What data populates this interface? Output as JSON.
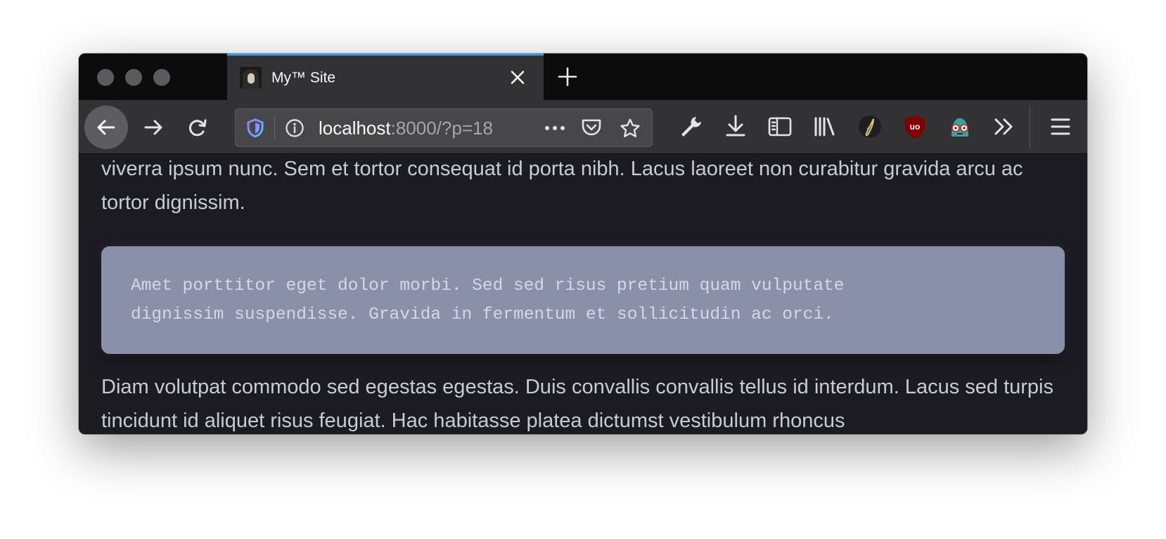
{
  "tab": {
    "title": "My™ Site",
    "favicon": "portrait-favicon"
  },
  "toolbar": {
    "url_host": "localhost",
    "url_rest": ":8000/?p=18",
    "icons": [
      "back-arrow-icon",
      "forward-arrow-icon",
      "reload-icon",
      "tracking-shield-icon",
      "site-info-icon",
      "page-actions-icon",
      "pocket-icon",
      "bookmark-star-icon",
      "wrench-icon",
      "download-icon",
      "sidebar-icon",
      "library-icon",
      "extension-pencil-icon",
      "ublock-origin-icon",
      "extension-mascot-icon",
      "overflow-chevron-icon",
      "hamburger-menu-icon"
    ]
  },
  "colors": {
    "tab_accent": "#2e9bff",
    "page_background": "#1c1b22",
    "code_background": "#8a90a8"
  },
  "content": {
    "para_top": "viverra ipsum nunc. Sem et tortor consequat id porta nibh. Lacus laoreet non curabitur gravida arcu ac tortor dignissim.",
    "code": "Amet porttitor eget dolor morbi. Sed sed risus pretium quam vulputate\ndignissim suspendisse. Gravida in fermentum et sollicitudin ac orci.",
    "para_bottom": "Diam volutpat commodo sed egestas egestas. Duis convallis convallis tellus id interdum. Lacus sed turpis tincidunt id aliquet risus feugiat. Hac habitasse platea dictumst vestibulum rhoncus"
  }
}
